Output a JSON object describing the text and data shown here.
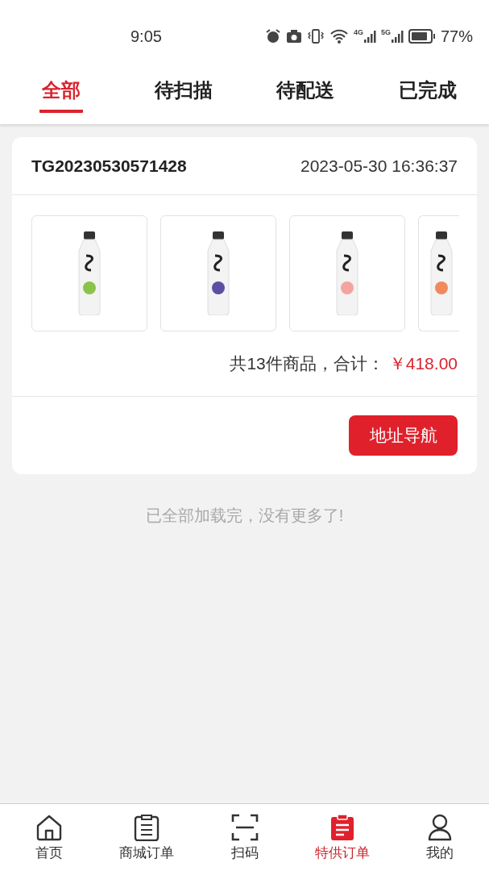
{
  "status_bar": {
    "time": "9:05",
    "network_1": "4G",
    "network_2": "5G",
    "battery": "77%"
  },
  "tabs": [
    {
      "label": "全部",
      "selected": true
    },
    {
      "label": "待扫描",
      "selected": false
    },
    {
      "label": "待配送",
      "selected": false
    },
    {
      "label": "已完成",
      "selected": false
    }
  ],
  "orders": [
    {
      "order_no": "TG20230530571428",
      "time": "2023-05-30 16:36:37",
      "products": [
        {
          "color": "#8bc34a"
        },
        {
          "color": "#5a4fa0"
        },
        {
          "color": "#f4a3a0"
        },
        {
          "color": "#f08a5d"
        }
      ],
      "summary": "共13件商品，合计：",
      "total": "￥418.00",
      "action": "地址导航"
    }
  ],
  "footer_note": "已全部加载完，没有更多了!",
  "bottom_nav": [
    {
      "kind": "home",
      "label": "首页",
      "selected": false
    },
    {
      "kind": "list",
      "label": "商城订单",
      "selected": false
    },
    {
      "kind": "scan",
      "label": "扫码",
      "selected": false
    },
    {
      "kind": "list",
      "label": "特供订单",
      "selected": true
    },
    {
      "kind": "user",
      "label": "我的",
      "selected": false
    }
  ]
}
